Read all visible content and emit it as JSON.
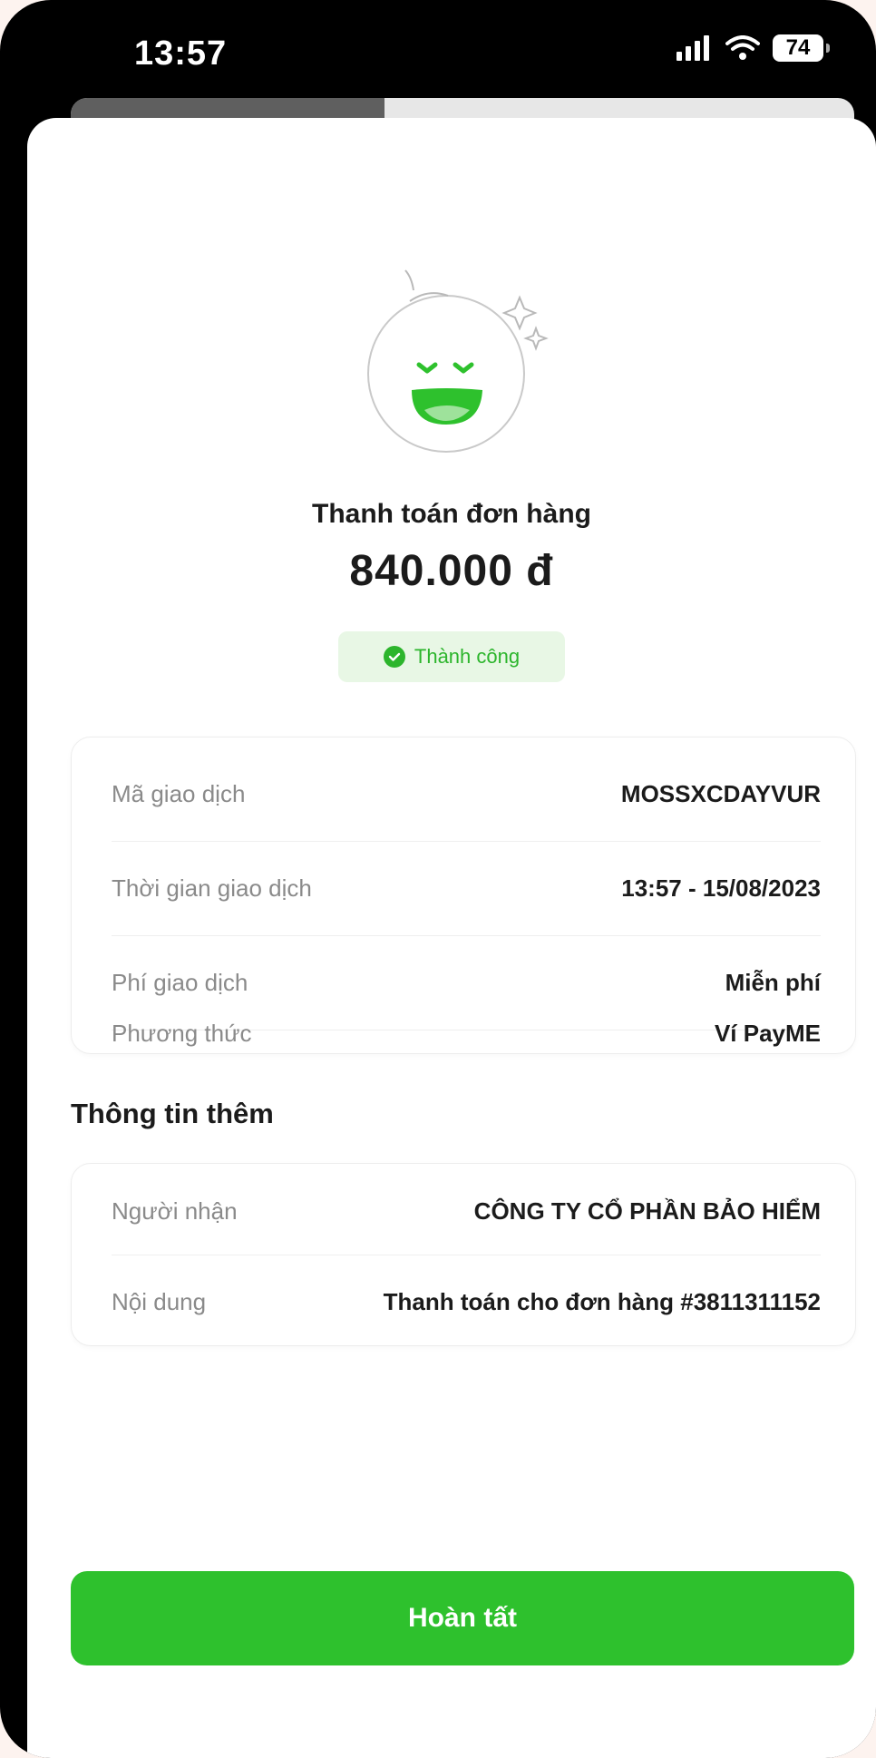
{
  "status_bar": {
    "time": "13:57",
    "battery": "74"
  },
  "progress": {
    "fraction": 0.4
  },
  "receipt": {
    "title": "Thanh toán đơn hàng",
    "amount": "840.000 đ",
    "status": "Thành công",
    "details": [
      {
        "label": "Mã giao dịch",
        "value": "MOSSXCDAYVUR"
      },
      {
        "label": "Thời gian giao dịch",
        "value": "13:57 - 15/08/2023"
      },
      {
        "label": "Phí giao dịch",
        "value": "Miễn phí"
      },
      {
        "label": "Phương thức",
        "value": "Ví PayME"
      }
    ]
  },
  "extra_info": {
    "title": "Thông tin thêm",
    "rows": [
      {
        "label": "Người nhận",
        "value": "CÔNG TY CỔ PHẦN BẢO HIỂM"
      },
      {
        "label": "Nội dung",
        "value": "Thanh toán cho đơn hàng #3811311152"
      }
    ]
  },
  "actions": {
    "done_label": "Hoàn tất"
  },
  "colors": {
    "accent": "#2ec12d",
    "success_text": "#2cb52c",
    "success_bg": "#e8f7e5"
  }
}
